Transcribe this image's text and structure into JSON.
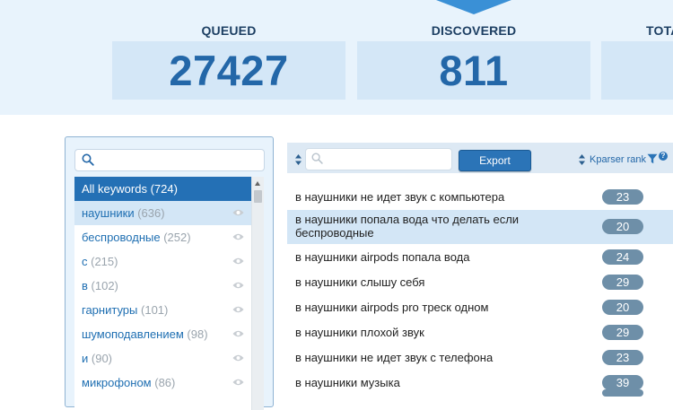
{
  "stats": [
    {
      "label": "QUEUED",
      "value": "27427"
    },
    {
      "label": "DISCOVERED",
      "value": "811"
    },
    {
      "label": "TOTA",
      "value": ""
    }
  ],
  "keywords_panel": {
    "search_placeholder": "",
    "items": [
      {
        "word": "All keywords",
        "count": "(724)",
        "state": "active"
      },
      {
        "word": "наушники",
        "count": "(636)",
        "state": "selected"
      },
      {
        "word": "беспроводные",
        "count": "(252)",
        "state": ""
      },
      {
        "word": "с",
        "count": "(215)",
        "state": ""
      },
      {
        "word": "в",
        "count": "(102)",
        "state": ""
      },
      {
        "word": "гарнитуры",
        "count": "(101)",
        "state": ""
      },
      {
        "word": "шумоподавлением",
        "count": "(98)",
        "state": ""
      },
      {
        "word": "и",
        "count": "(90)",
        "state": ""
      },
      {
        "word": "микрофоном",
        "count": "(86)",
        "state": ""
      }
    ]
  },
  "results": {
    "search_placeholder": "",
    "export_label": "Export",
    "rank_column_label": "Kparser rank",
    "help_label": "?",
    "rows": [
      {
        "keyword": "в наушники не идет звук с компьютера",
        "rank": "23"
      },
      {
        "keyword": "в наушники попала вода что делать если беспроводные",
        "rank": "20"
      },
      {
        "keyword": "в наушники airpods попала вода",
        "rank": "24"
      },
      {
        "keyword": "в наушники слышу себя",
        "rank": "29"
      },
      {
        "keyword": "в наушники airpods pro треск одном",
        "rank": "20"
      },
      {
        "keyword": "в наушники плохой звук",
        "rank": "29"
      },
      {
        "keyword": "в наушники не идет звук с телефона",
        "rank": "23"
      },
      {
        "keyword": "в наушники музыка",
        "rank": "39"
      }
    ]
  },
  "colors": {
    "accent": "#2470b5",
    "stat_number": "#2367a8",
    "rank_badge": "#6e8fa8"
  }
}
